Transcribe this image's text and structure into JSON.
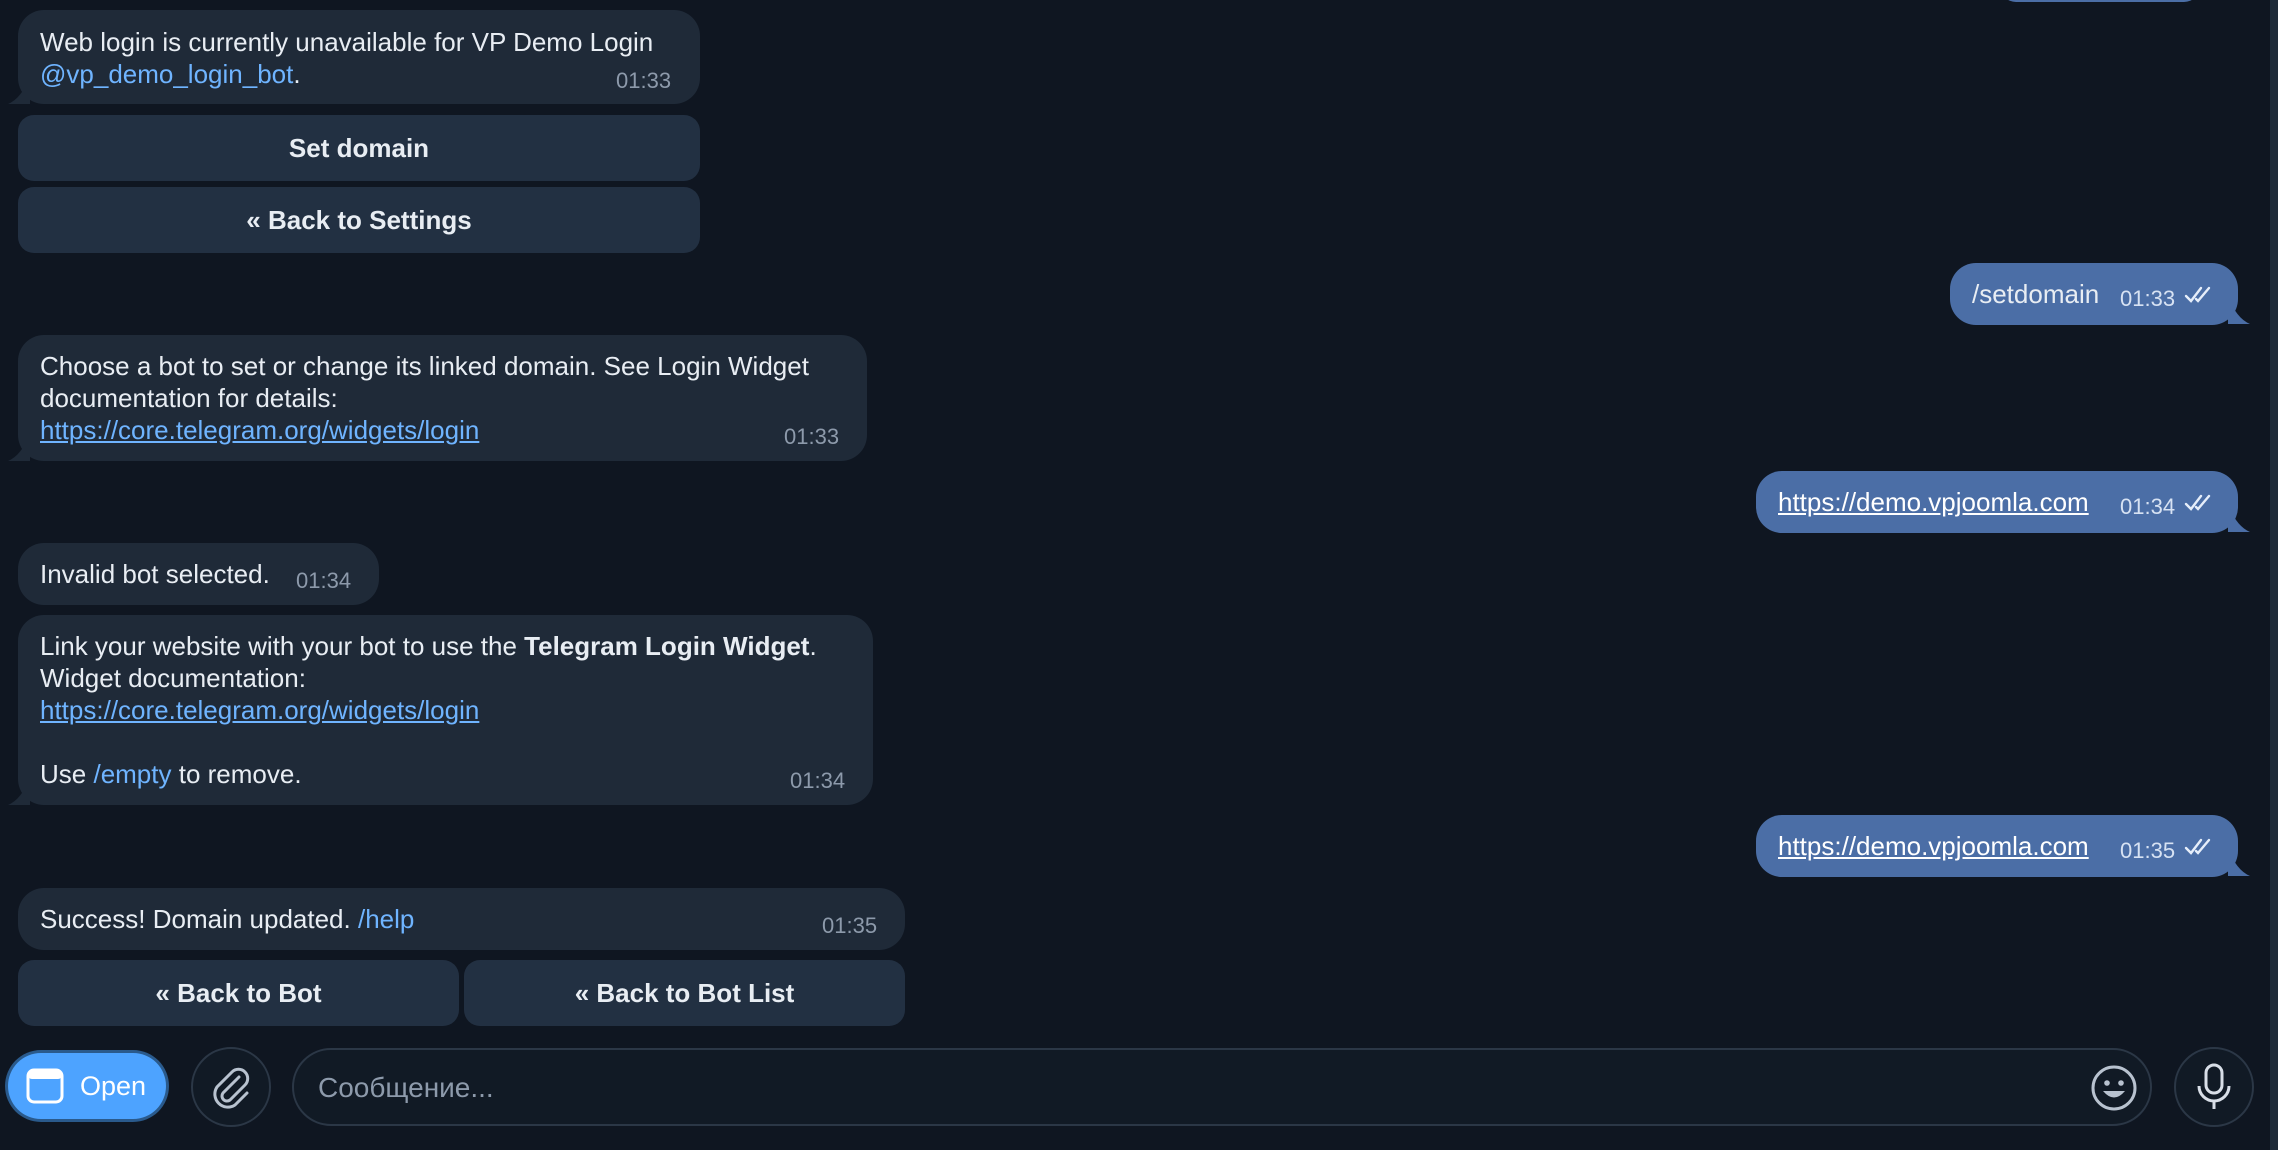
{
  "messages": {
    "m1": {
      "line1": "Web login is currently unavailable for VP Demo Login",
      "mention": "@vp_demo_login_bot",
      "period": ".",
      "time": "01:33"
    },
    "m1_buttons": {
      "set_domain": "Set domain",
      "back_settings": "« Back to Settings"
    },
    "m2": {
      "text": "/setdomain",
      "time": "01:33"
    },
    "m3": {
      "line1": "Choose a bot to set or change its linked domain. See Login Widget",
      "line2": "documentation for details:",
      "link": "https://core.telegram.org/widgets/login",
      "time": "01:33"
    },
    "m4": {
      "link": "https://demo.vpjoomla.com",
      "time": "01:34"
    },
    "m5": {
      "text": "Invalid bot selected.",
      "time": "01:34"
    },
    "m6": {
      "line1_pre": "Link your website with your bot to use the ",
      "line1_bold": "Telegram Login Widget",
      "line1_post": ".",
      "line2": "Widget documentation:",
      "link": "https://core.telegram.org/widgets/login",
      "use_pre": "Use ",
      "use_cmd": "/empty",
      "use_post": " to remove.",
      "time": "01:34"
    },
    "m7": {
      "link": "https://demo.vpjoomla.com",
      "time": "01:35"
    },
    "m8": {
      "text": "Success! Domain updated. ",
      "cmd": "/help",
      "time": "01:35"
    },
    "m8_buttons": {
      "back_bot": "« Back to Bot",
      "back_bot_list": "« Back to Bot List"
    }
  },
  "composer": {
    "open_label": "Open",
    "placeholder": "Сообщение..."
  },
  "colors": {
    "background": "#0f1621",
    "incoming": "#1f2a38",
    "outgoing": "#4b6ea6",
    "link": "#6fb4ff",
    "open_button": "#4da3ff"
  },
  "icons": [
    "window-icon",
    "paperclip-icon",
    "emoji-icon",
    "microphone-icon",
    "double-check-icon"
  ]
}
